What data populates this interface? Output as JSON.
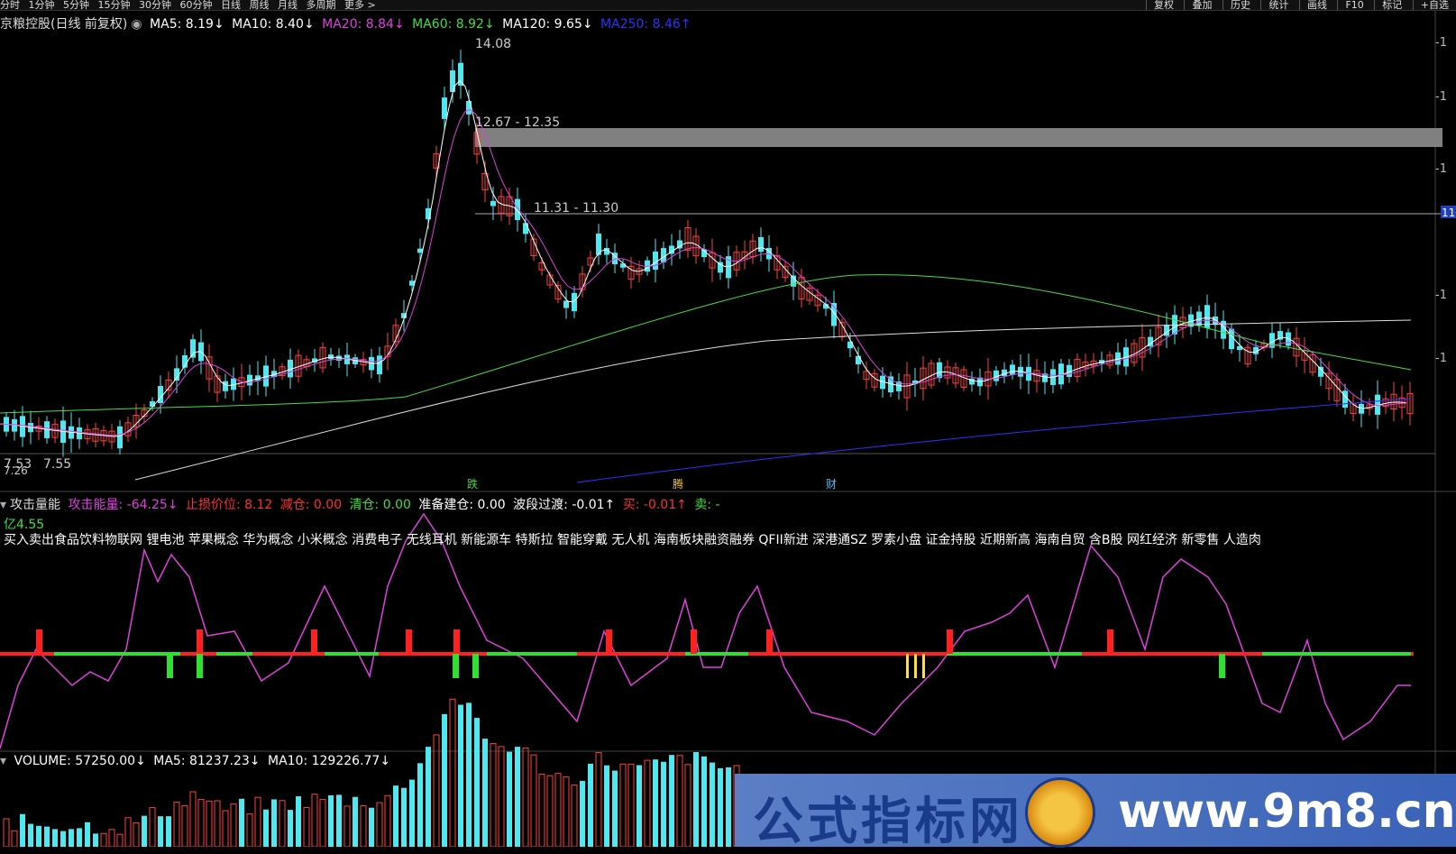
{
  "toolbar": {
    "periods": [
      "分时",
      "1分钟",
      "5分钟",
      "15分钟",
      "30分钟",
      "60分钟",
      "日线",
      "周线",
      "月线",
      "多周期",
      "更多 >"
    ],
    "right": [
      "复权",
      "叠加",
      "历史",
      "统计",
      "画线",
      "F10",
      "标记",
      "+自选"
    ]
  },
  "main": {
    "title": "京粮控股(日线 前复权)",
    "ma": [
      {
        "label": "MA5: 8.19↓",
        "color": "#ffffff"
      },
      {
        "label": "MA10: 8.40↓",
        "color": "#ffffff"
      },
      {
        "label": "MA20: 8.84↓",
        "color": "#e040e0"
      },
      {
        "label": "MA60: 8.92↓",
        "color": "#40e040"
      },
      {
        "label": "MA120: 9.65↓",
        "color": "#ffffff"
      },
      {
        "label": "MA250: 8.46↑",
        "color": "#3030ff"
      }
    ],
    "annotations": {
      "high": "14.08",
      "band1": "12.67 - 12.35",
      "band2": "11.31 - 11.30",
      "low1": "7.53",
      "low2": "7.55",
      "low3": "7.26",
      "right_tag": "11"
    },
    "event_markers": [
      "跌",
      "腾",
      "财"
    ]
  },
  "indicator": {
    "title": "攻击量能",
    "items": [
      {
        "label": "攻击能量: -64.25↓",
        "color": "#e040e0"
      },
      {
        "label": "止损价位: 8.12",
        "color": "#ff3030"
      },
      {
        "label": "减仓: 0.00",
        "color": "#ff3030"
      },
      {
        "label": "清仓: 0.00",
        "color": "#40e040"
      },
      {
        "label": "准备建仓: 0.00",
        "color": "#ffffff"
      },
      {
        "label": "波段过渡: -0.01↑",
        "color": "#ffffff"
      },
      {
        "label": "买: -0.01↑",
        "color": "#ff3030"
      },
      {
        "label": "卖: -",
        "color": "#40e040"
      }
    ],
    "sub_label": "亿4.55",
    "concepts": "买入卖出食品饮料物联网 锂电池 苹果概念 华为概念 小米概念 消费电子 无线耳机 新能源车 特斯拉 智能穿戴 无人机 海南板块融资融券 QFII新进 深港通SZ 罗素小盘 证金持股 近期新高 海南自贸 含B股 网红经济 新零售 人造肉"
  },
  "volume": {
    "items": [
      {
        "label": "VOLUME: 57250.00↓",
        "color": "#ffffff"
      },
      {
        "label": "MA5: 81237.23↓",
        "color": "#ffffff"
      },
      {
        "label": "MA10: 129226.77↓",
        "color": "#ffffff"
      }
    ]
  },
  "watermark": {
    "cn": "公式指标网",
    "url": "www.9m8.cn"
  },
  "colors": {
    "up": "#ff4040",
    "down": "#50e8f0",
    "ma5": "#ffffff",
    "ma20": "#e040e0",
    "ma60": "#40e040",
    "ma250": "#3030ff",
    "band": "#808080"
  }
}
